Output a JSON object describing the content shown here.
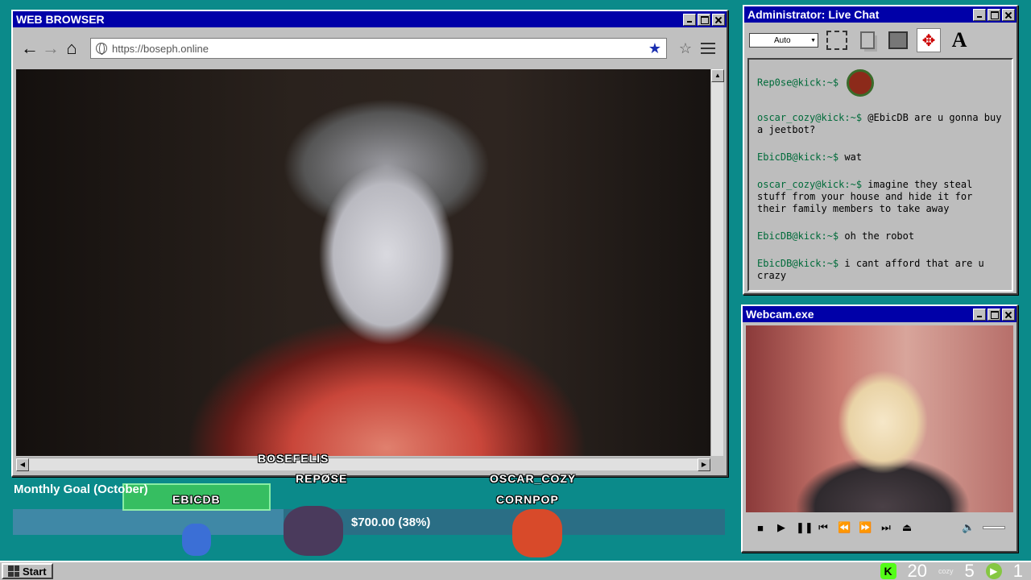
{
  "browser": {
    "title": "WEB BROWSER",
    "url": "https://boseph.online"
  },
  "chat": {
    "title": "Administrator: Live Chat",
    "zoom_select": "Auto",
    "messages": [
      {
        "user": "Rep0se@kick:~$",
        "text": ""
      },
      {
        "user": "oscar_cozy@kick:~$",
        "text": "@EbicDB are u gonna buy a jeetbot?"
      },
      {
        "user": "EbicDB@kick:~$",
        "text": "wat"
      },
      {
        "user": "oscar_cozy@kick:~$",
        "text": "imagine they steal stuff from your house and hide it for their family members to take away"
      },
      {
        "user": "EbicDB@kick:~$",
        "text": "oh the robot"
      },
      {
        "user": "EbicDB@kick:~$",
        "text": "i cant afford that are u crazy"
      }
    ]
  },
  "webcam": {
    "title": "Webcam.exe"
  },
  "goal": {
    "label": "Monthly Goal (October)",
    "progress_text": "$700.00 (38%)",
    "percent": 38
  },
  "viewers": {
    "bosefelis": "BOSEFELIS",
    "repose": "REPØSE",
    "oscar": "OSCAR_COZY",
    "ebicdb": "EBICDB",
    "cornpop": "CORNPOP"
  },
  "taskbar": {
    "start": "Start",
    "kick_icon_letter": "K",
    "count_a": "20",
    "cozy": "cozy",
    "count_b": "5",
    "count_c": "1"
  },
  "colors": {
    "desktop": "#0b8a8a",
    "titlebar": "#0000a8",
    "chat_user": "#006b3a",
    "goal_bar": "#2a6e85"
  }
}
